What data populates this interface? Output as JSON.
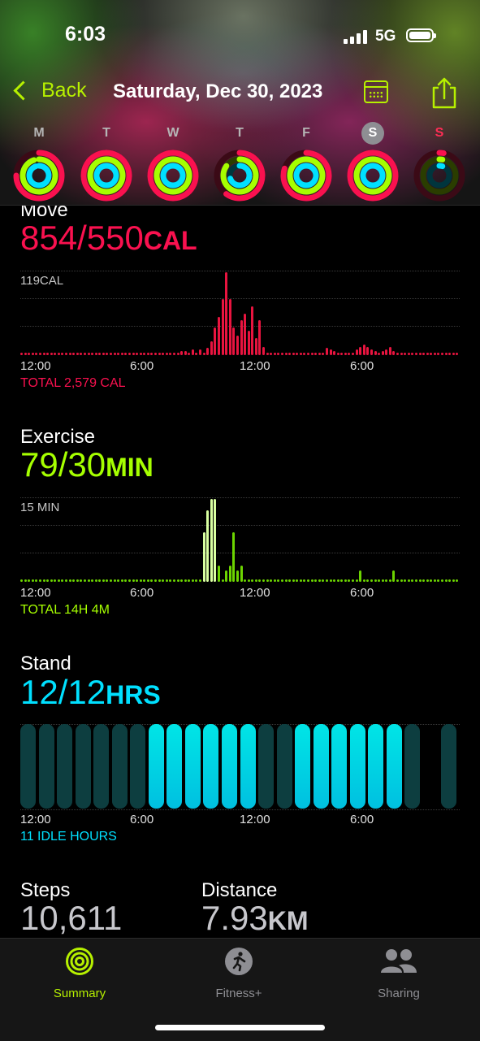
{
  "status": {
    "time": "6:03",
    "network": "5G"
  },
  "nav": {
    "back_label": "Back",
    "date_title": "Saturday, Dec 30, 2023"
  },
  "week": {
    "days": [
      "M",
      "T",
      "W",
      "T",
      "F",
      "S",
      "S"
    ],
    "selected_index": 5,
    "today_index": 6
  },
  "colors": {
    "move": "#fa114f",
    "exercise": "#a6ff00",
    "stand": "#00e0ff",
    "accent": "#b6f000"
  },
  "move": {
    "title": "Move",
    "value": "854/550",
    "unit": "CAL",
    "ymax_label": "119CAL",
    "total": "TOTAL 2,579 CAL"
  },
  "exercise": {
    "title": "Exercise",
    "value": "79/30",
    "unit": "MIN",
    "ymax_label": "15 MIN",
    "total": "TOTAL 14H 4M"
  },
  "stand": {
    "title": "Stand",
    "value": "12/12",
    "unit": "HRS",
    "total": "11 IDLE HOURS"
  },
  "time_ticks": [
    "12:00",
    "6:00",
    "12:00",
    "6:00"
  ],
  "steps": {
    "label": "Steps",
    "value": "10,611"
  },
  "distance": {
    "label": "Distance",
    "value": "7.93",
    "unit": "KM"
  },
  "tabs": [
    {
      "label": "Summary",
      "icon": "activity-rings-icon",
      "active": true
    },
    {
      "label": "Fitness+",
      "icon": "running-figure-icon",
      "active": false
    },
    {
      "label": "Sharing",
      "icon": "people-icon",
      "active": false
    }
  ],
  "chart_data": [
    {
      "type": "bar",
      "title": "Move",
      "x_ticks": [
        "12:00",
        "6:00",
        "12:00",
        "6:00"
      ],
      "ymax_label": "119CAL",
      "ylim": [
        0,
        119
      ],
      "values": [
        2,
        2,
        2,
        2,
        2,
        2,
        2,
        2,
        2,
        2,
        2,
        2,
        2,
        2,
        2,
        2,
        2,
        2,
        2,
        2,
        2,
        2,
        2,
        2,
        2,
        2,
        2,
        2,
        2,
        2,
        2,
        2,
        2,
        2,
        2,
        2,
        2,
        2,
        2,
        2,
        2,
        2,
        2,
        6,
        6,
        4,
        8,
        4,
        8,
        4,
        10,
        20,
        40,
        55,
        80,
        119,
        80,
        40,
        28,
        50,
        60,
        35,
        70,
        25,
        50,
        12,
        2,
        4,
        2,
        2,
        2,
        2,
        2,
        2,
        2,
        2,
        2,
        2,
        2,
        2,
        2,
        4,
        10,
        8,
        6,
        4,
        2,
        2,
        2,
        4,
        8,
        12,
        15,
        12,
        8,
        6,
        4,
        6,
        8,
        12,
        6,
        2,
        2,
        2,
        2,
        2,
        2,
        2,
        2,
        2,
        2,
        2,
        2,
        2,
        2,
        2,
        2,
        2
      ],
      "total": "TOTAL 2,579 CAL"
    },
    {
      "type": "bar",
      "title": "Exercise",
      "x_ticks": [
        "12:00",
        "6:00",
        "12:00",
        "6:00"
      ],
      "ymax_label": "15 MIN",
      "ylim": [
        0,
        15
      ],
      "values": [
        0,
        0,
        0,
        0,
        0,
        0,
        0,
        0,
        0,
        0,
        0,
        0,
        0,
        0,
        0,
        0,
        0,
        0,
        0,
        0,
        0,
        0,
        0,
        0,
        0,
        0,
        0,
        0,
        0,
        0,
        0,
        0,
        0,
        0,
        0,
        0,
        0,
        0,
        0,
        0,
        0,
        0,
        0,
        0,
        0,
        0,
        0,
        0,
        0,
        9,
        13,
        15,
        15,
        3,
        0,
        2,
        3,
        9,
        2,
        3,
        0,
        0,
        0,
        0,
        0,
        0,
        0,
        0,
        0,
        0,
        0,
        0,
        0,
        0,
        0,
        0,
        0,
        0,
        0,
        0,
        0,
        0,
        0,
        0,
        0,
        0,
        0,
        0,
        0,
        0,
        0,
        2,
        0,
        0,
        0,
        0,
        0,
        0,
        0,
        0,
        2,
        0,
        0,
        0,
        0,
        0,
        0,
        0,
        0,
        0,
        0,
        0,
        0,
        0,
        0,
        0,
        0,
        0
      ],
      "total": "TOTAL 14H 4M"
    },
    {
      "type": "bar",
      "title": "Stand",
      "x_ticks": [
        "12:00",
        "6:00",
        "12:00",
        "6:00"
      ],
      "hours_stood": [
        0,
        0,
        0,
        0,
        0,
        0,
        0,
        1,
        1,
        1,
        1,
        1,
        1,
        0,
        0,
        1,
        1,
        1,
        1,
        1,
        1,
        0,
        0,
        0
      ],
      "total": "11 IDLE HOURS"
    }
  ]
}
